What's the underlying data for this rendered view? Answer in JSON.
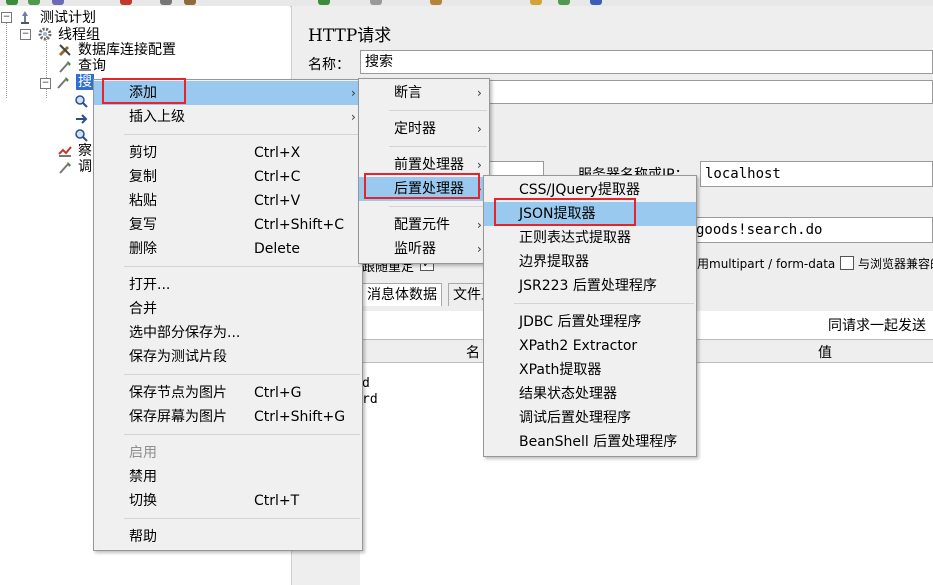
{
  "tree": {
    "items": [
      {
        "label": "测试计划"
      },
      {
        "label": "线程组"
      },
      {
        "label": "数据库连接配置"
      },
      {
        "label": "查询"
      },
      {
        "label": "搜"
      },
      {
        "label": "察"
      },
      {
        "label": "调"
      }
    ]
  },
  "panel": {
    "title": "HTTP请求",
    "name_label": "名称：",
    "name_value": "搜索",
    "server_label": "服务器名称或IP：",
    "server_value": "localhost",
    "path_value": "goods!search.do",
    "follow_redirect_fragment": "跟随重定",
    "multipart_label": "使用multipart / form-data",
    "browser_compat_label": "与浏览器兼容的",
    "tabs": [
      "消息体数据",
      "文件上"
    ],
    "send_with_request": "同请求一起发送",
    "columns": {
      "name": "名",
      "value": "值"
    },
    "rows": [
      "d",
      "rd"
    ]
  },
  "context_menu": {
    "items": [
      {
        "label": "添加",
        "shortcut": "",
        "submenu": true
      },
      {
        "label": "插入上级",
        "shortcut": "",
        "submenu": true
      },
      {
        "label": "剪切",
        "shortcut": "Ctrl+X"
      },
      {
        "label": "复制",
        "shortcut": "Ctrl+C"
      },
      {
        "label": "粘贴",
        "shortcut": "Ctrl+V"
      },
      {
        "label": "复写",
        "shortcut": "Ctrl+Shift+C"
      },
      {
        "label": "删除",
        "shortcut": "Delete"
      },
      {
        "label": "打开...",
        "shortcut": ""
      },
      {
        "label": "合并",
        "shortcut": ""
      },
      {
        "label": "选中部分保存为...",
        "shortcut": ""
      },
      {
        "label": "保存为测试片段",
        "shortcut": ""
      },
      {
        "label": "保存节点为图片",
        "shortcut": "Ctrl+G"
      },
      {
        "label": "保存屏幕为图片",
        "shortcut": "Ctrl+Shift+G"
      },
      {
        "label": "启用",
        "shortcut": "",
        "disabled": true
      },
      {
        "label": "禁用",
        "shortcut": ""
      },
      {
        "label": "切换",
        "shortcut": "Ctrl+T"
      },
      {
        "label": "帮助",
        "shortcut": ""
      }
    ]
  },
  "add_submenu": {
    "items": [
      {
        "label": "断言"
      },
      {
        "label": "定时器"
      },
      {
        "label": "前置处理器"
      },
      {
        "label": "后置处理器"
      },
      {
        "label": "配置元件"
      },
      {
        "label": "监听器"
      }
    ]
  },
  "postprocessor_submenu": {
    "items": [
      {
        "label": "CSS/JQuery提取器"
      },
      {
        "label": "JSON提取器"
      },
      {
        "label": "正则表达式提取器"
      },
      {
        "label": "边界提取器"
      },
      {
        "label": "JSR223 后置处理程序"
      },
      {
        "label": "JDBC 后置处理程序"
      },
      {
        "label": "XPath2 Extractor"
      },
      {
        "label": "XPath提取器"
      },
      {
        "label": "结果状态处理器"
      },
      {
        "label": "调试后置处理程序"
      },
      {
        "label": "BeanShell 后置处理程序"
      }
    ]
  },
  "colors": {
    "highlight": "#99c9ef",
    "annotation_box": "#e8242b",
    "menu_bg": "#f0f0f0"
  }
}
